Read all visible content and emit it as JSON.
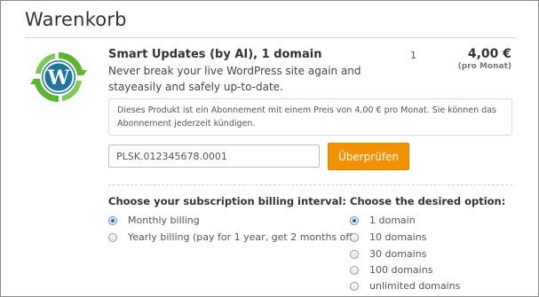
{
  "page": {
    "title": "Warenkorb"
  },
  "product": {
    "name": "Smart Updates (by AI), 1 domain",
    "description": "Never break your live WordPress site again and stayeasily and safely up-to-date.",
    "quantity": "1",
    "price": "4,00 €",
    "price_period": "(pro Monat)",
    "logo_icon": "wordpress-update-icon",
    "info_text": "Dieses Produkt ist ein Abonnement mit einem Preis von 4,00 € pro Monat. Sie können das Abonnement jederzeit kündigen."
  },
  "license": {
    "value": "PLSK.012345678.0001",
    "check_label": "Überprüfen"
  },
  "billing": {
    "heading": "Choose your subscription billing interval:",
    "options": [
      {
        "label": "Monthly billing",
        "checked": true
      },
      {
        "label": "Yearly billing (pay for 1 year, get 2 months off)",
        "checked": false
      }
    ]
  },
  "domains": {
    "heading": "Choose the desired option:",
    "options": [
      {
        "label": "1 domain",
        "checked": true
      },
      {
        "label": "10 domains",
        "checked": false
      },
      {
        "label": "30 domains",
        "checked": false
      },
      {
        "label": "100 domains",
        "checked": false
      },
      {
        "label": "unlimited domains",
        "checked": false
      }
    ]
  },
  "colors": {
    "accent_button": "#f39200",
    "logo_green": "#5cb531",
    "logo_blue": "#21759b"
  }
}
